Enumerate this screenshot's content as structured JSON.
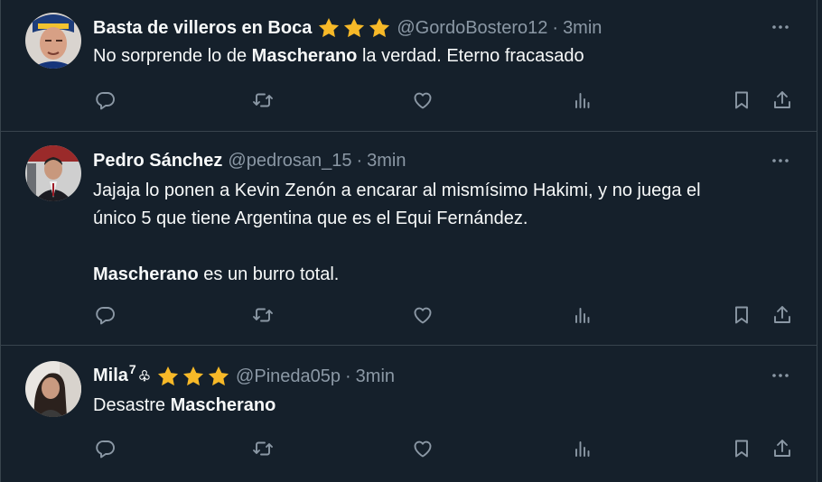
{
  "tweets": [
    {
      "name": "Basta de villeros en Boca",
      "handle": "@GordoBostero12",
      "dot": "·",
      "time": "3min",
      "body": [
        {
          "pre": "No sorprende lo de ",
          "bold": "Mascherano",
          "post": " la verdad. Eterno fracasado"
        }
      ],
      "stars": 3
    },
    {
      "name": "Pedro Sánchez",
      "handle": "@pedrosan_15",
      "dot": "·",
      "time": "3min",
      "body_line1": "Jajaja lo ponen a Kevin Zenón a encarar al mismísimo Hakimi, y no juega el",
      "body_line2": "único 5 que tiene Argentina que es el Equi Fernández.",
      "body_bold": "Mascherano",
      "body_post": " es un burro total.",
      "stars": 0
    },
    {
      "name": "Mila",
      "name_sup": "7",
      "name_suit": "♧",
      "handle": "@Pineda05p",
      "dot": "·",
      "time": "3min",
      "body_pre": "Desastre ",
      "body_bold": "Mascherano",
      "stars": 3
    }
  ],
  "icons": {
    "more": "more-icon",
    "reply": "reply-icon",
    "retweet": "retweet-icon",
    "like": "like-icon",
    "views": "views-icon",
    "bookmark": "bookmark-icon",
    "share": "share-icon"
  },
  "colors": {
    "background": "#15202b",
    "border": "#38444d",
    "text": "#f7f9f9",
    "secondary": "#8b98a5",
    "star": "#f7b928"
  }
}
